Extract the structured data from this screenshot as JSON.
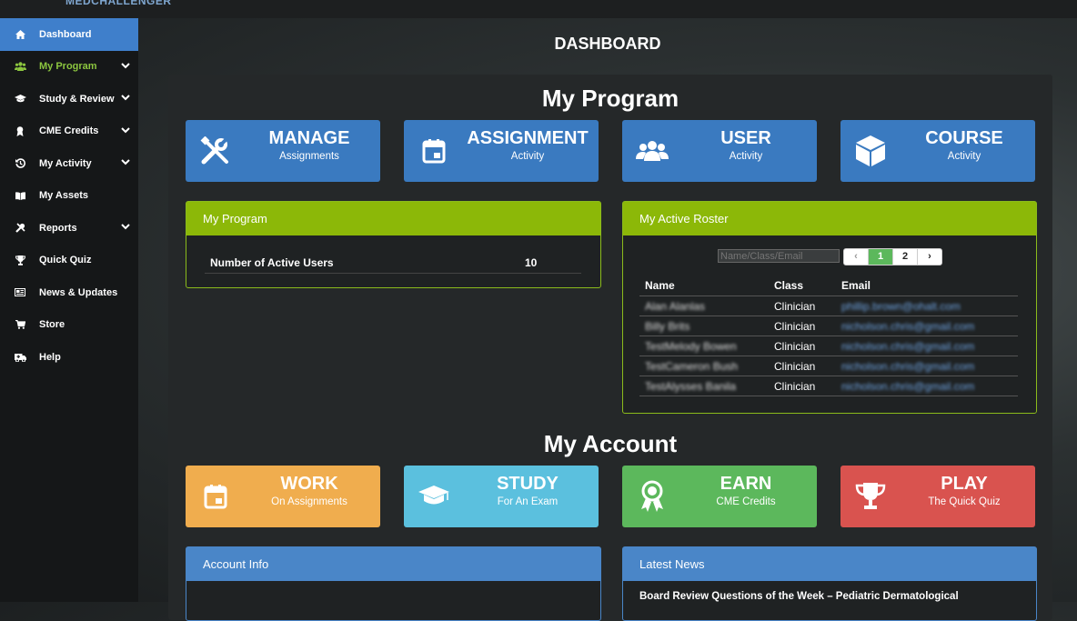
{
  "app": {
    "logo": "MEDCHALLENGER",
    "page_title": "DASHBOARD"
  },
  "sidebar": {
    "items": [
      {
        "label": "Dashboard",
        "icon": "home-icon",
        "active": true
      },
      {
        "label": "My Program",
        "icon": "users-icon",
        "expandable": true
      },
      {
        "label": "Study & Review",
        "icon": "graduation-cap-icon",
        "expandable": true
      },
      {
        "label": "CME Credits",
        "icon": "award-icon",
        "expandable": true
      },
      {
        "label": "My Activity",
        "icon": "history-icon",
        "expandable": true
      },
      {
        "label": "My Assets",
        "icon": "book-icon"
      },
      {
        "label": "Reports",
        "icon": "wrench-icon",
        "expandable": true
      },
      {
        "label": "Quick Quiz",
        "icon": "trophy-icon"
      },
      {
        "label": "News & Updates",
        "icon": "newspaper-icon"
      },
      {
        "label": "Store",
        "icon": "cart-icon"
      },
      {
        "label": "Help",
        "icon": "ambulance-icon"
      }
    ]
  },
  "program": {
    "title": "My Program",
    "tiles": [
      {
        "main": "MANAGE",
        "sub": "Assignments",
        "icon": "tools-icon",
        "color": "#3a7ac0"
      },
      {
        "main": "ASSIGNMENT",
        "sub": "Activity",
        "icon": "calendar-icon",
        "color": "#3a7ac0"
      },
      {
        "main": "USER",
        "sub": "Activity",
        "icon": "users-icon",
        "color": "#3a7ac0"
      },
      {
        "main": "COURSE",
        "sub": "Activity",
        "icon": "cube-icon",
        "color": "#3a7ac0"
      }
    ],
    "summary_box": {
      "title": "My Program",
      "stat_label": "Number of Active Users",
      "stat_value": "10"
    },
    "roster_box": {
      "title": "My Active Roster",
      "search_placeholder": "Name/Class/Email",
      "pager": {
        "prev": "‹",
        "pages": [
          "1",
          "2"
        ],
        "next": "›",
        "current": "1"
      },
      "columns": [
        "Name",
        "Class",
        "Email"
      ],
      "rows": [
        {
          "name": "Alan Alanlas",
          "class": "Clinician",
          "email": "phillip.brown@ohalt.com"
        },
        {
          "name": "Billy Brits",
          "class": "Clinician",
          "email": "nicholson.chris@gmail.com"
        },
        {
          "name": "TestMelody Bowen",
          "class": "Clinician",
          "email": "nicholson.chris@gmail.com"
        },
        {
          "name": "TestCameron Bush",
          "class": "Clinician",
          "email": "nicholson.chris@gmail.com"
        },
        {
          "name": "TestAlysses Banila",
          "class": "Clinician",
          "email": "nicholson.chris@gmail.com"
        }
      ]
    }
  },
  "account": {
    "title": "My Account",
    "tiles": [
      {
        "main": "WORK",
        "sub": "On Assignments",
        "icon": "calendar-icon",
        "color": "#f0ad4e"
      },
      {
        "main": "STUDY",
        "sub": "For An Exam",
        "icon": "graduation-cap-icon",
        "color": "#5bc0de"
      },
      {
        "main": "EARN",
        "sub": "CME Credits",
        "icon": "award-icon",
        "color": "#5cb85c"
      },
      {
        "main": "PLAY",
        "sub": "The Quick Quiz",
        "icon": "trophy-icon",
        "color": "#d9534f"
      }
    ],
    "info_box": {
      "title": "Account Info"
    },
    "news_box": {
      "title": "Latest News",
      "headline": "Board Review Questions of the Week – Pediatric Dermatological"
    }
  }
}
